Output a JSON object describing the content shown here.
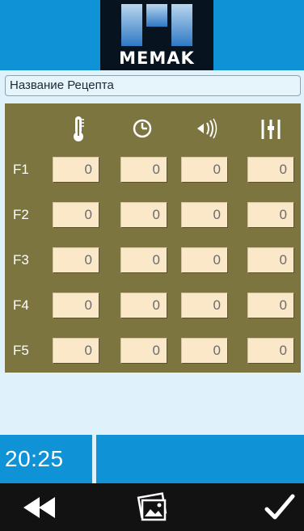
{
  "header": {
    "logo_text": "MEMAK"
  },
  "recipe": {
    "name": "Название Рецепта"
  },
  "columns": [
    {
      "icon": "thermometer-icon"
    },
    {
      "icon": "clock-icon"
    },
    {
      "icon": "fan-speed-icon"
    },
    {
      "icon": "sliders-icon"
    }
  ],
  "rows": [
    {
      "label": "F1",
      "values": [
        "0",
        "0",
        "0",
        "0"
      ]
    },
    {
      "label": "F2",
      "values": [
        "0",
        "0",
        "0",
        "0"
      ]
    },
    {
      "label": "F3",
      "values": [
        "0",
        "0",
        "0",
        "0"
      ]
    },
    {
      "label": "F4",
      "values": [
        "0",
        "0",
        "0",
        "0"
      ]
    },
    {
      "label": "F5",
      "values": [
        "0",
        "0",
        "0",
        "0"
      ]
    }
  ],
  "status": {
    "time": "20:25"
  },
  "toolbar": {
    "back_icon": "rewind-icon",
    "gallery_icon": "image-gallery-icon",
    "confirm_icon": "checkmark-icon"
  },
  "colors": {
    "header": "#0f92d6",
    "panel": "#7d7540",
    "cell": "#fbe8c9",
    "background": "#dff1fb",
    "toolbar": "#121212"
  }
}
